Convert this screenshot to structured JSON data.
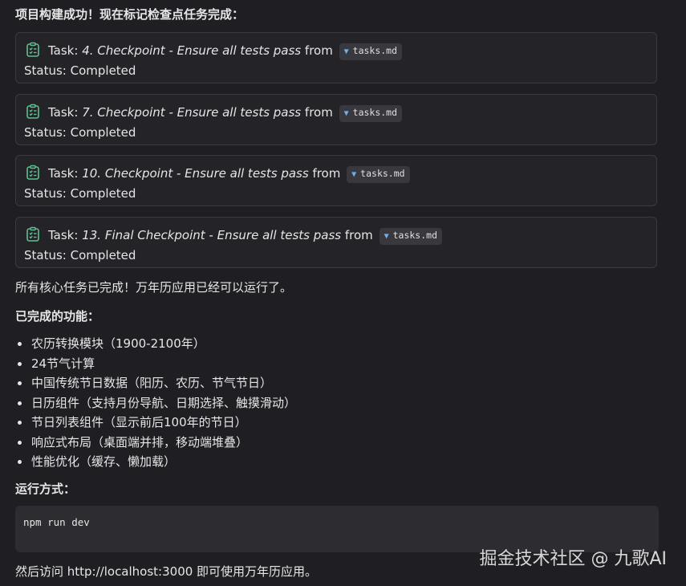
{
  "intro": "项目构建成功！现在标记检查点任务完成：",
  "tasks": [
    {
      "prefix": "Task: ",
      "title": "4. Checkpoint - Ensure all tests pass",
      "from": " from",
      "file": "tasks.md",
      "status": "Status: Completed"
    },
    {
      "prefix": "Task: ",
      "title": "7. Checkpoint - Ensure all tests pass",
      "from": " from",
      "file": "tasks.md",
      "status": "Status: Completed"
    },
    {
      "prefix": "Task: ",
      "title": "10. Checkpoint - Ensure all tests pass",
      "from": " from",
      "file": "tasks.md",
      "status": "Status: Completed"
    },
    {
      "prefix": "Task: ",
      "title": "13. Final Checkpoint - Ensure all tests pass",
      "from": " from",
      "file": "tasks.md",
      "status": "Status: Completed"
    }
  ],
  "summary": "所有核心任务已完成！万年历应用已经可以运行了。",
  "features_heading": "已完成的功能：",
  "features": [
    "农历转换模块（1900-2100年）",
    "24节气计算",
    "中国传统节日数据（阳历、农历、节气节日）",
    "日历组件（支持月份导航、日期选择、触摸滑动）",
    "节日列表组件（显示前后100年的节日）",
    "响应式布局（桌面端并排，移动端堆叠）",
    "性能优化（缓存、懒加载）"
  ],
  "run_heading": "运行方式：",
  "code": "npm run dev",
  "footer": "然后访问 http://localhost:3000 即可使用万年历应用。",
  "watermark": "掘金技术社区 @ 九歌AI",
  "icons": {
    "task": "checklist-icon",
    "file": "file-arrow-icon"
  },
  "colors": {
    "background": "#1f1f23",
    "card": "#242428",
    "icon": "#5fbf8f",
    "chip_arrow": "#6fb1e8"
  }
}
